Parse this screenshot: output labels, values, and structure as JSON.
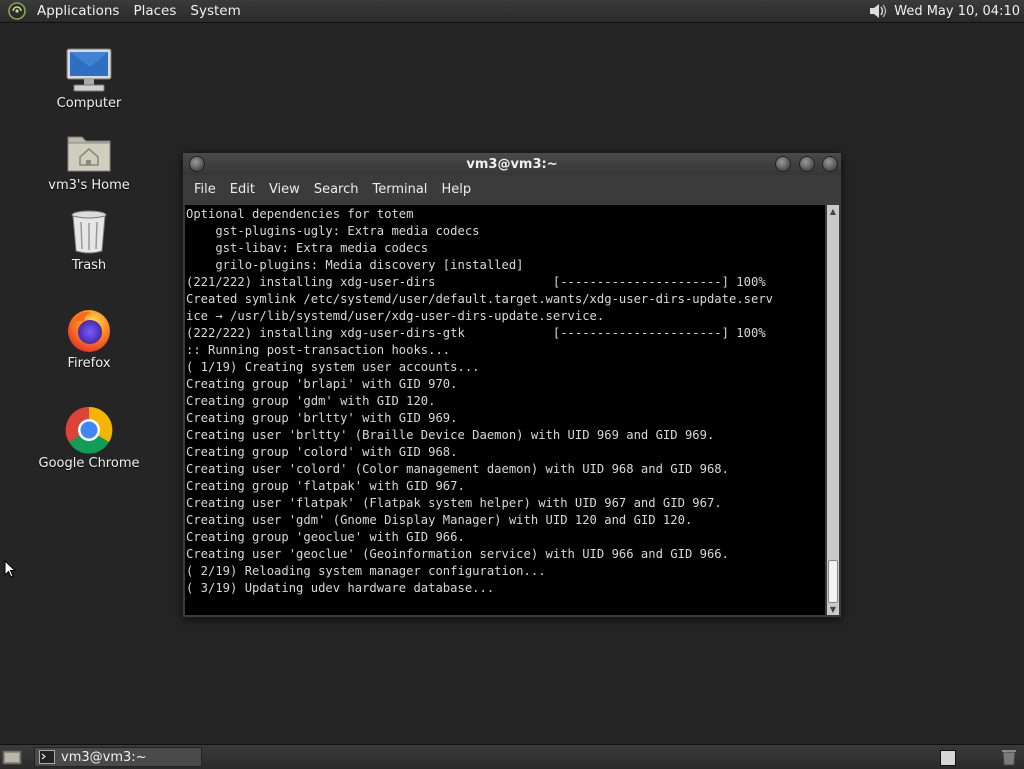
{
  "top_panel": {
    "menus": [
      "Applications",
      "Places",
      "System"
    ],
    "clock": "Wed May 10, 04:10",
    "icons": {
      "logo": "distro-logo-icon",
      "volume": "speaker-icon"
    }
  },
  "desktop": {
    "icons": [
      {
        "label": "Computer",
        "icon": "computer-icon"
      },
      {
        "label": "vm3's Home",
        "icon": "home-folder-icon"
      },
      {
        "label": "Trash",
        "icon": "trash-icon"
      },
      {
        "label": "Firefox",
        "icon": "firefox-icon"
      },
      {
        "label": "Google Chrome",
        "icon": "chrome-icon"
      }
    ]
  },
  "terminal": {
    "title": "vm3@vm3:~",
    "menu": [
      "File",
      "Edit",
      "View",
      "Search",
      "Terminal",
      "Help"
    ],
    "lines": [
      "Optional dependencies for totem",
      "    gst-plugins-ugly: Extra media codecs",
      "    gst-libav: Extra media codecs",
      "    grilo-plugins: Media discovery [installed]",
      "(221/222) installing xdg-user-dirs                [----------------------] 100%",
      "Created symlink /etc/systemd/user/default.target.wants/xdg-user-dirs-update.serv",
      "ice → /usr/lib/systemd/user/xdg-user-dirs-update.service.",
      "(222/222) installing xdg-user-dirs-gtk            [----------------------] 100%",
      ":: Running post-transaction hooks...",
      "( 1/19) Creating system user accounts...",
      "Creating group 'brlapi' with GID 970.",
      "Creating group 'gdm' with GID 120.",
      "Creating group 'brltty' with GID 969.",
      "Creating user 'brltty' (Braille Device Daemon) with UID 969 and GID 969.",
      "Creating group 'colord' with GID 968.",
      "Creating user 'colord' (Color management daemon) with UID 968 and GID 968.",
      "Creating group 'flatpak' with GID 967.",
      "Creating user 'flatpak' (Flatpak system helper) with UID 967 and GID 967.",
      "Creating user 'gdm' (Gnome Display Manager) with UID 120 and GID 120.",
      "Creating group 'geoclue' with GID 966.",
      "Creating user 'geoclue' (Geoinformation service) with UID 966 and GID 966.",
      "( 2/19) Reloading system manager configuration...",
      "( 3/19) Updating udev hardware database..."
    ]
  },
  "taskbar": {
    "tasks": [
      {
        "label": "vm3@vm3:~",
        "icon": "terminal-icon"
      }
    ]
  },
  "colors": {
    "desktop_bg": "#252525",
    "terminal_bg": "#000000",
    "terminal_fg": "#d8d8d8",
    "panel_bg": "#333333"
  }
}
